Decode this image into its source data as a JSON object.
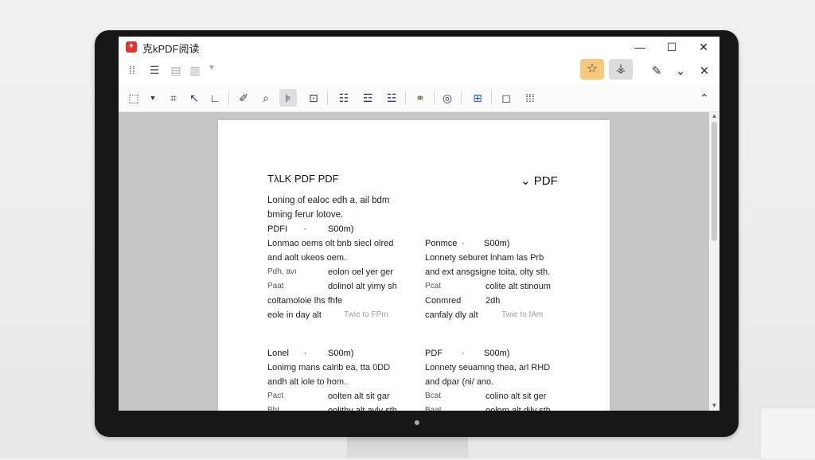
{
  "window": {
    "title": "克kPDF阅读",
    "controls": {
      "minimize": "—",
      "maximize": "☐",
      "close": "✕"
    }
  },
  "row2": {
    "icons": [
      "grid-dots-icon",
      "layout-icon",
      "layers-icon",
      "stack-icon",
      "dropdown-arrow-icon"
    ],
    "right_icons": [
      "star-icon",
      "bookmark-stand-icon",
      "pen-icon",
      "chevron-down-icon",
      "close-icon"
    ]
  },
  "toolbar": {
    "icons": [
      "select-tool-icon",
      "dropdown-icon",
      "crop-icon",
      "pointer-icon",
      "line-tool-icon",
      "pin-icon",
      "search-icon",
      "text-align-icon",
      "frame-icon",
      "list-icon",
      "list-edit-icon",
      "form-icon",
      "link-icon",
      "zoom-icon",
      "grid-view-icon",
      "comment-icon",
      "table-icon",
      "collapse-icon"
    ]
  },
  "document": {
    "title": "TλLK PDF PDF",
    "right_heading": "PDF",
    "right_heading_prefix": "⌄",
    "intro_lines": [
      "Loning of ealoc edh a, ail bdm",
      "bming ferur lotove."
    ],
    "sections": [
      {
        "header_left": "PDFI",
        "header_mid": "·",
        "header_right": "S00m)",
        "lines": [
          "Lonmao oems olt bnb siecl olred",
          "and aolt ukeos oem."
        ],
        "pairs": [
          [
            "Pdh, avı",
            "eolon oel yer ger"
          ],
          [
            "Paat",
            "dolinol alt yimy sh"
          ],
          [
            "coltamoloie lhs fhfe",
            ""
          ],
          [
            "eole in day alt",
            "Twie to FPm"
          ]
        ]
      },
      {
        "header_left": "Ponmce",
        "header_mid": "·",
        "header_right": "S00m)",
        "lines": [
          "Lonnety seburet lnham las Prb",
          "and ext ansgsigne toita, olty sth."
        ],
        "pairs": [
          [
            "Pcat",
            "colite alt stinoum"
          ],
          [
            "Conmred",
            "2dh"
          ],
          [
            "canfaly dly alt",
            "Twie to fAm"
          ]
        ]
      },
      {
        "header_left": "Lonel",
        "header_mid": "·",
        "header_right": "S00m)",
        "lines": [
          "Lonimg mans calrib ea, tta 0DD",
          "andh alt iole to hom."
        ],
        "pairs": [
          [
            "Pact",
            "oolten alt sit gar"
          ],
          [
            "Bht",
            "oolithy alt avly sth"
          ]
        ]
      },
      {
        "header_left": "PDF",
        "header_mid": "·",
        "header_right": "S00m)",
        "lines": [
          "Lonnety seuamng thea, arl RHD",
          "and dpar (ni/ ano."
        ],
        "pairs": [
          [
            "Bcat",
            "colino alt sit ger"
          ],
          [
            "Baat",
            "oolom alt dily sth"
          ]
        ]
      }
    ]
  }
}
